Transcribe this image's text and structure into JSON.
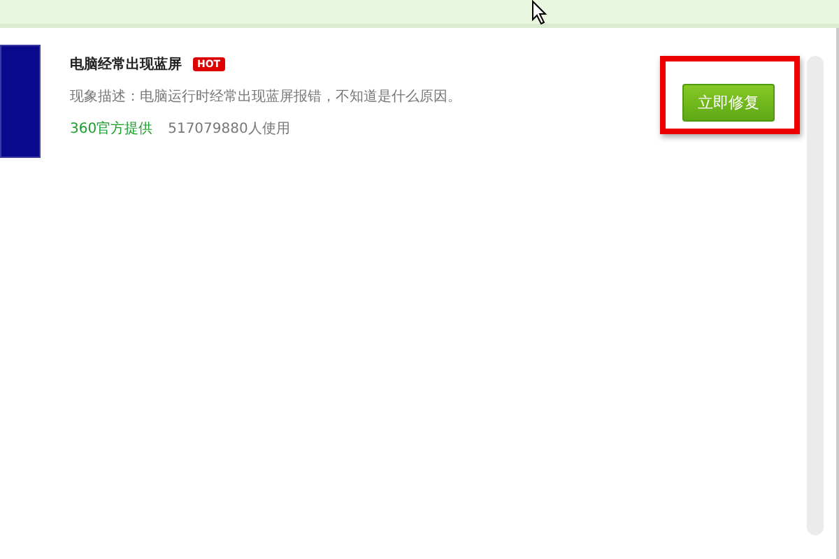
{
  "item": {
    "title": "电脑经常出现蓝屏",
    "badge": "HOT",
    "description": "现象描述：电脑运行时经常出现蓝屏报错，不知道是什么原因。",
    "provider": "360官方提供",
    "usage": "517079880人使用",
    "button": "立即修复",
    "highlighted": true
  }
}
